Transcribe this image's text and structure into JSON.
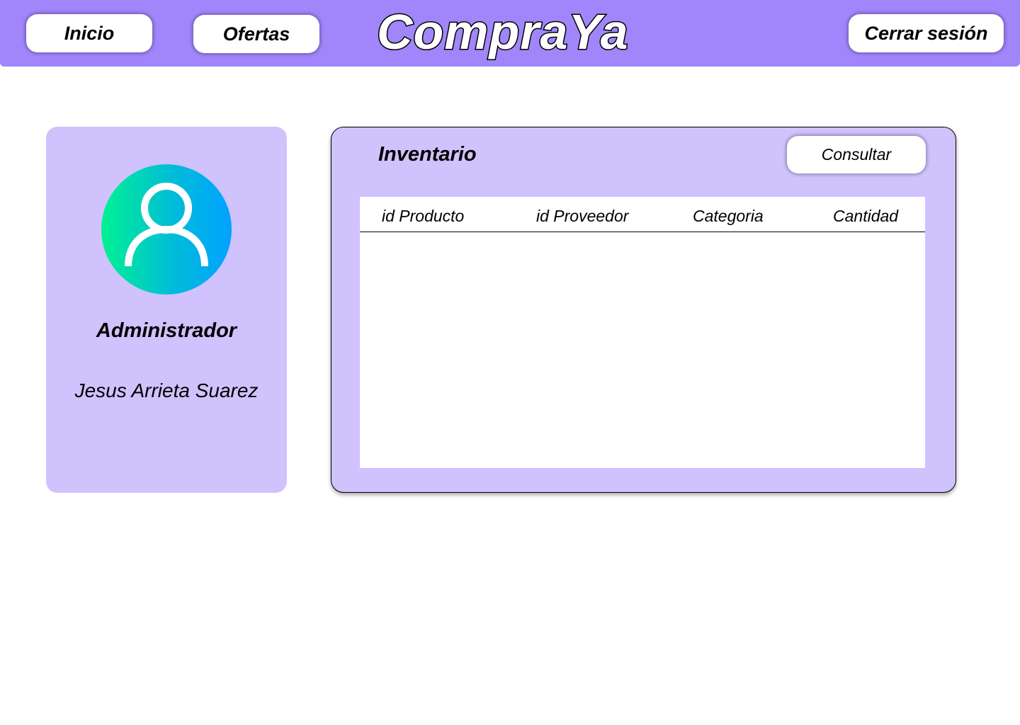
{
  "header": {
    "brand": "CompraYa",
    "nav": {
      "inicio": "Inicio",
      "ofertas": "Ofertas",
      "logout": "Cerrar sesión"
    },
    "background_color": "#a085fb"
  },
  "profile": {
    "avatar_icon": "user-icon",
    "role": "Administrador",
    "name": "Jesus Arrieta Suarez",
    "card_color": "#cfc2fd"
  },
  "inventory": {
    "title": "Inventario",
    "consult_button": "Consultar",
    "columns": [
      "id Producto",
      "id Proveedor",
      "Categoria",
      "Cantidad"
    ],
    "rows": []
  }
}
